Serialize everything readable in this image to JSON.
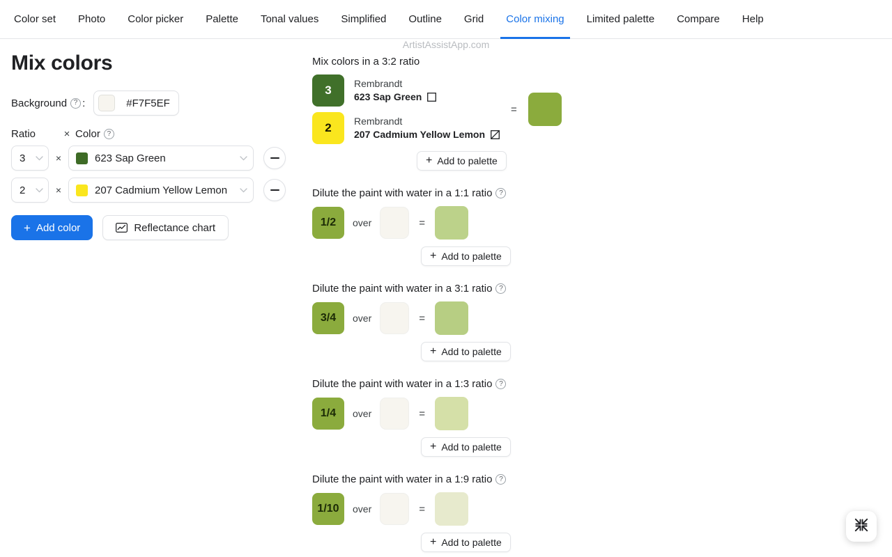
{
  "nav": {
    "items": [
      {
        "label": "Color set",
        "active": false
      },
      {
        "label": "Photo",
        "active": false
      },
      {
        "label": "Color picker",
        "active": false
      },
      {
        "label": "Palette",
        "active": false
      },
      {
        "label": "Tonal values",
        "active": false
      },
      {
        "label": "Simplified",
        "active": false
      },
      {
        "label": "Outline",
        "active": false
      },
      {
        "label": "Grid",
        "active": false
      },
      {
        "label": "Color mixing",
        "active": true
      },
      {
        "label": "Limited palette",
        "active": false
      },
      {
        "label": "Compare",
        "active": false
      },
      {
        "label": "Help",
        "active": false
      }
    ],
    "accent_color": "#1a73e8"
  },
  "watermark": "ArtistAssistApp.com",
  "left": {
    "title": "Mix colors",
    "background": {
      "label": "Background",
      "help": "?",
      "colon": ":",
      "hex": "#F7F5EF",
      "swatch_color": "#F7F5EF"
    },
    "headers": {
      "ratio": "Ratio",
      "times": "×",
      "color": "Color",
      "help": "?"
    },
    "color_rows": [
      {
        "ratio": "3",
        "times": "×",
        "swatch_color": "#3E6B26",
        "name": "623 Sap Green",
        "caret": "⌄",
        "remove_label": "remove"
      },
      {
        "ratio": "2",
        "times": "×",
        "swatch_color": "#FAE61E",
        "name": "207 Cadmium Yellow Lemon",
        "caret": "⌄",
        "remove_label": "remove"
      }
    ],
    "buttons": {
      "add_color": "Add color",
      "add_color_plus": "+",
      "reflectance_chart": "Reflectance chart"
    }
  },
  "right": {
    "mix": {
      "title": "Mix colors in a 3:2 ratio",
      "items": [
        {
          "amount": "3",
          "badge_bg": "#40702A",
          "badge_fg": "#FFFFFF",
          "brand": "Rembrandt",
          "name": "623 Sap Green",
          "opacity_icon": "opaque-square-icon"
        },
        {
          "amount": "2",
          "badge_bg": "#FAE61E",
          "badge_fg": "#1A1A00",
          "brand": "Rembrandt",
          "name": "207 Cadmium Yellow Lemon",
          "opacity_icon": "semi-transparent-square-icon"
        }
      ],
      "equals": "=",
      "result_color": "#8BAB3D",
      "add_to_palette": "Add to palette",
      "add_to_palette_plus": "+"
    },
    "dilutions": [
      {
        "title": "Dilute the paint with water in a 1:1 ratio",
        "help": "?",
        "fraction": "1/2",
        "fraction_bg": "#8BAB3D",
        "over": "over",
        "base_color": "#F7F5EF",
        "equals": "=",
        "result_color": "#BCD28A",
        "add_to_palette": "Add to palette",
        "add_to_palette_plus": "+"
      },
      {
        "title": "Dilute the paint with water in a 3:1 ratio",
        "help": "?",
        "fraction": "3/4",
        "fraction_bg": "#8BAB3D",
        "over": "over",
        "base_color": "#F7F5EF",
        "equals": "=",
        "result_color": "#B7CE83",
        "add_to_palette": "Add to palette",
        "add_to_palette_plus": "+"
      },
      {
        "title": "Dilute the paint with water in a 1:3 ratio",
        "help": "?",
        "fraction": "1/4",
        "fraction_bg": "#8BAB3D",
        "over": "over",
        "base_color": "#F7F5EF",
        "equals": "=",
        "result_color": "#D5E0A8",
        "add_to_palette": "Add to palette",
        "add_to_palette_plus": "+"
      },
      {
        "title": "Dilute the paint with water in a 1:9 ratio",
        "help": "?",
        "fraction": "1/10",
        "fraction_bg": "#8BAB3D",
        "over": "over",
        "base_color": "#F7F5EF",
        "equals": "=",
        "result_color": "#E7EACD",
        "add_to_palette": "Add to palette",
        "add_to_palette_plus": "+"
      }
    ]
  },
  "fullscreen_button": {
    "icon": "exit-fullscreen-icon"
  }
}
